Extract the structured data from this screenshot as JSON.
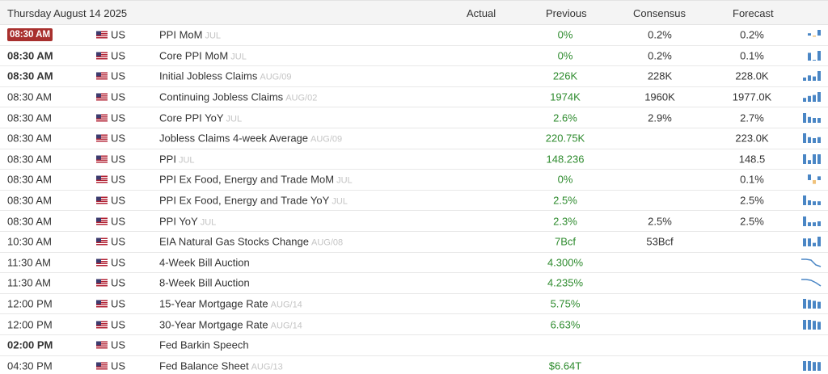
{
  "header": {
    "date": "Thursday August 14 2025",
    "actual": "Actual",
    "previous": "Previous",
    "consensus": "Consensus",
    "forecast": "Forecast"
  },
  "rows": [
    {
      "time": "08:30 AM",
      "country": "US",
      "event": "PPI MoM",
      "ref": "JUL",
      "actual": "",
      "previous": "0%",
      "consensus": "0.2%",
      "forecast": "0.2%",
      "spark": "bars",
      "bars": [
        2,
        -1,
        5
      ],
      "colors": [
        "#4a86c5",
        "#f0c27b",
        "#4a86c5"
      ]
    },
    {
      "time": "08:30 AM",
      "country": "US",
      "event": "Core PPI MoM",
      "ref": "JUL",
      "actual": "",
      "previous": "0%",
      "consensus": "0.2%",
      "forecast": "0.1%",
      "spark": "bars",
      "bars": [
        4,
        0,
        5
      ],
      "colors": [
        "#4a86c5",
        "#4a86c5",
        "#4a86c5"
      ]
    },
    {
      "time": "08:30 AM",
      "country": "US",
      "event": "Initial Jobless Claims",
      "ref": "AUG/09",
      "actual": "",
      "previous": "226K",
      "consensus": "228K",
      "forecast": "228.0K",
      "spark": "bars",
      "bars": [
        3,
        5,
        4,
        9
      ],
      "colors": [
        "#4a86c5",
        "#4a86c5",
        "#4a86c5",
        "#4a86c5"
      ]
    },
    {
      "time": "08:30 AM",
      "country": "US",
      "event": "Continuing Jobless Claims",
      "ref": "AUG/02",
      "actual": "",
      "previous": "1974K",
      "consensus": "1960K",
      "forecast": "1977.0K",
      "spark": "bars",
      "bars": [
        4,
        6,
        7,
        10
      ],
      "colors": [
        "#4a86c5",
        "#4a86c5",
        "#4a86c5",
        "#4a86c5"
      ]
    },
    {
      "time": "08:30 AM",
      "country": "US",
      "event": "Core PPI YoY",
      "ref": "JUL",
      "actual": "",
      "previous": "2.6%",
      "consensus": "2.9%",
      "forecast": "2.7%",
      "spark": "bars",
      "bars": [
        10,
        6,
        5,
        5
      ],
      "colors": [
        "#4a86c5",
        "#4a86c5",
        "#4a86c5",
        "#4a86c5"
      ]
    },
    {
      "time": "08:30 AM",
      "country": "US",
      "event": "Jobless Claims 4-week Average",
      "ref": "AUG/09",
      "actual": "",
      "previous": "220.75K",
      "consensus": "",
      "forecast": "223.0K",
      "spark": "bars",
      "bars": [
        10,
        6,
        5,
        6
      ],
      "colors": [
        "#4a86c5",
        "#4a86c5",
        "#4a86c5",
        "#4a86c5"
      ]
    },
    {
      "time": "08:30 AM",
      "country": "US",
      "event": "PPI",
      "ref": "JUL",
      "actual": "",
      "previous": "148.236",
      "consensus": "",
      "forecast": "148.5",
      "spark": "bars",
      "bars": [
        10,
        4,
        10,
        10
      ],
      "colors": [
        "#4a86c5",
        "#4a86c5",
        "#4a86c5",
        "#4a86c5"
      ]
    },
    {
      "time": "08:30 AM",
      "country": "US",
      "event": "PPI Ex Food, Energy and Trade MoM",
      "ref": "JUL",
      "actual": "",
      "previous": "0%",
      "consensus": "",
      "forecast": "0.1%",
      "spark": "bars",
      "bars": [
        3,
        -2,
        2
      ],
      "colors": [
        "#4a86c5",
        "#f0c27b",
        "#4a86c5"
      ]
    },
    {
      "time": "08:30 AM",
      "country": "US",
      "event": "PPI Ex Food, Energy and Trade YoY",
      "ref": "JUL",
      "actual": "",
      "previous": "2.5%",
      "consensus": "",
      "forecast": "2.5%",
      "spark": "bars",
      "bars": [
        10,
        5,
        4,
        4
      ],
      "colors": [
        "#4a86c5",
        "#4a86c5",
        "#4a86c5",
        "#4a86c5"
      ]
    },
    {
      "time": "08:30 AM",
      "country": "US",
      "event": "PPI YoY",
      "ref": "JUL",
      "actual": "",
      "previous": "2.3%",
      "consensus": "2.5%",
      "forecast": "2.5%",
      "spark": "bars",
      "bars": [
        10,
        4,
        4,
        5
      ],
      "colors": [
        "#4a86c5",
        "#4a86c5",
        "#4a86c5",
        "#4a86c5"
      ]
    },
    {
      "time": "10:30 AM",
      "country": "US",
      "event": "EIA Natural Gas Stocks Change",
      "ref": "AUG/08",
      "actual": "",
      "previous": "7Bcf",
      "consensus": "53Bcf",
      "forecast": "",
      "spark": "bars",
      "bars": [
        9,
        9,
        4,
        11
      ],
      "colors": [
        "#4a86c5",
        "#4a86c5",
        "#4a86c5",
        "#4a86c5"
      ]
    },
    {
      "time": "11:30 AM",
      "country": "US",
      "event": "4-Week Bill Auction",
      "ref": "",
      "actual": "",
      "previous": "4.300%",
      "consensus": "",
      "forecast": "",
      "spark": "line",
      "line": [
        10,
        10,
        9,
        3,
        1
      ]
    },
    {
      "time": "11:30 AM",
      "country": "US",
      "event": "8-Week Bill Auction",
      "ref": "",
      "actual": "",
      "previous": "4.235%",
      "consensus": "",
      "forecast": "",
      "spark": "line",
      "line": [
        10,
        10,
        9,
        6,
        2
      ]
    },
    {
      "time": "12:00 PM",
      "country": "US",
      "event": "15-Year Mortgage Rate",
      "ref": "AUG/14",
      "actual": "",
      "previous": "5.75%",
      "consensus": "",
      "forecast": "",
      "spark": "bars",
      "bars": [
        10,
        9,
        8,
        7
      ],
      "colors": [
        "#4a86c5",
        "#4a86c5",
        "#4a86c5",
        "#4a86c5"
      ]
    },
    {
      "time": "12:00 PM",
      "country": "US",
      "event": "30-Year Mortgage Rate",
      "ref": "AUG/14",
      "actual": "",
      "previous": "6.63%",
      "consensus": "",
      "forecast": "",
      "spark": "bars",
      "bars": [
        10,
        10,
        9,
        8
      ],
      "colors": [
        "#4a86c5",
        "#4a86c5",
        "#4a86c5",
        "#4a86c5"
      ]
    },
    {
      "time": "02:00 PM",
      "country": "US",
      "event": "Fed Barkin Speech",
      "ref": "",
      "actual": "",
      "previous": "",
      "consensus": "",
      "forecast": "",
      "spark": "none"
    },
    {
      "time": "04:30 PM",
      "country": "US",
      "event": "Fed Balance Sheet",
      "ref": "AUG/13",
      "actual": "",
      "previous": "$6.64T",
      "consensus": "",
      "forecast": "",
      "spark": "bars",
      "bars": [
        10,
        10,
        9,
        9
      ],
      "colors": [
        "#4a86c5",
        "#4a86c5",
        "#4a86c5",
        "#4a86c5"
      ]
    }
  ],
  "highlight_row": 0,
  "bold_rows": [
    1,
    2,
    15
  ]
}
